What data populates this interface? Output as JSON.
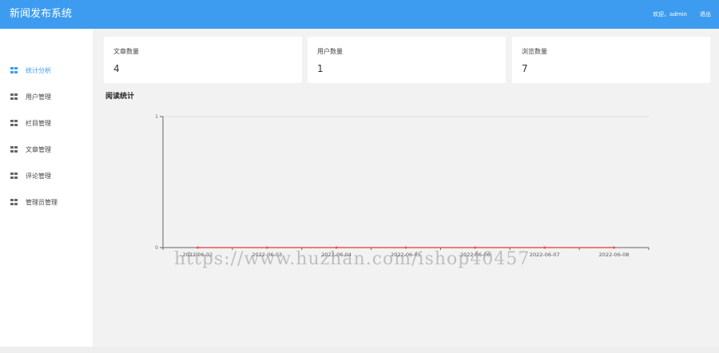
{
  "header": {
    "title": "新闻发布系统",
    "welcome": "欢迎，admin",
    "logout": "退出"
  },
  "sidebar": {
    "items": [
      {
        "label": "统计分析",
        "active": true
      },
      {
        "label": "用户管理"
      },
      {
        "label": "栏目管理"
      },
      {
        "label": "文章管理"
      },
      {
        "label": "评论管理"
      },
      {
        "label": "管理员管理"
      }
    ]
  },
  "stats": {
    "cards": [
      {
        "label": "文章数量",
        "value": "4"
      },
      {
        "label": "用户数量",
        "value": "1"
      },
      {
        "label": "浏览数量",
        "value": "7"
      }
    ]
  },
  "section": {
    "title": "阅读统计"
  },
  "watermark": "https://www.huzhan.com/ishop40457",
  "colors": {
    "accent": "#3d9cf0",
    "line": "#e05a4f"
  },
  "chart_data": {
    "type": "line",
    "x": [
      "2022-06-02",
      "2022-06-03",
      "2022-06-04",
      "2022-06-05",
      "2022-06-06",
      "2022-06-07",
      "2022-06-08"
    ],
    "series": [
      {
        "values": [
          0,
          0,
          0,
          0,
          0,
          0,
          0
        ]
      }
    ],
    "yticks": [
      "0",
      "1"
    ],
    "ylim": [
      0,
      1
    ],
    "grid": true
  }
}
